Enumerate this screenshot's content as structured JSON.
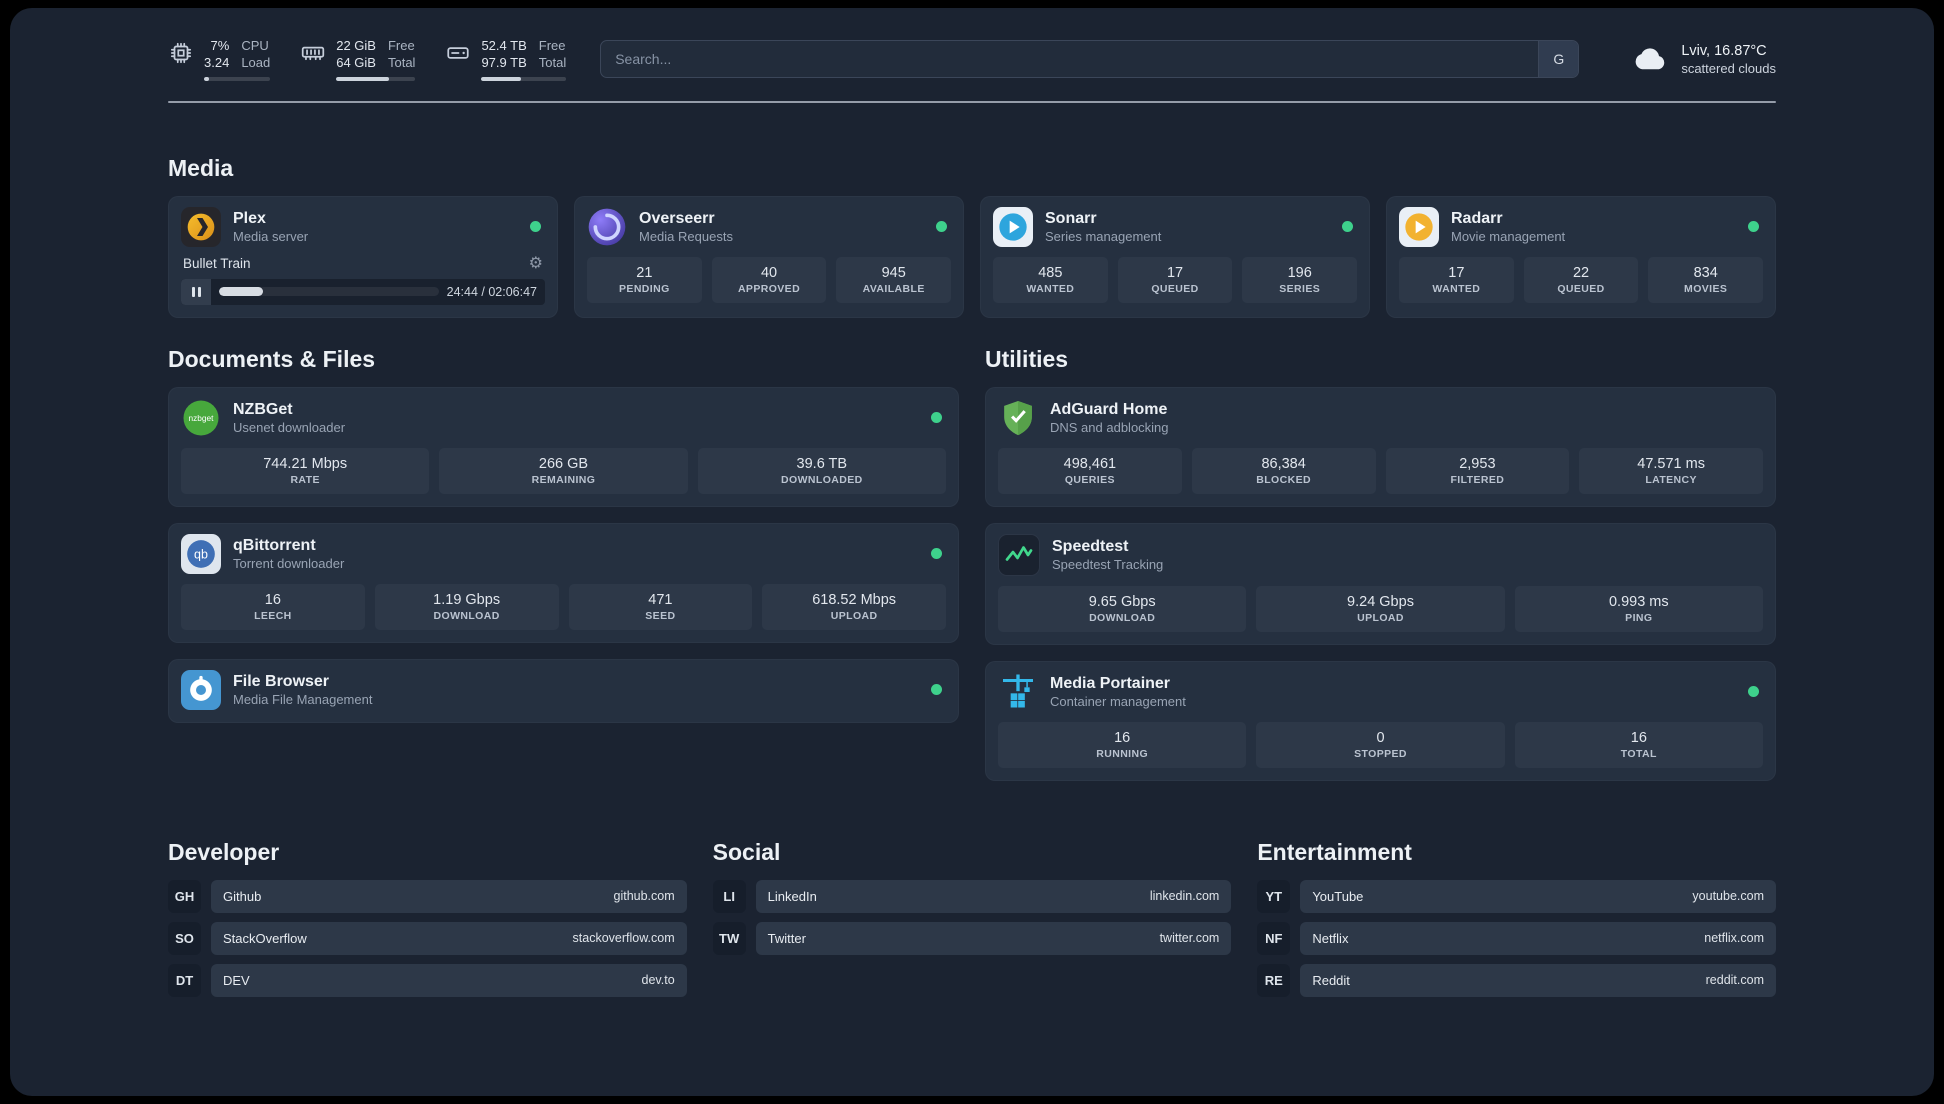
{
  "topbar": {
    "cpu": {
      "values": [
        "7%",
        "3.24"
      ],
      "labels": [
        "CPU",
        "Load"
      ],
      "progress_pct": 7
    },
    "memory": {
      "values": [
        "22 GiB",
        "64 GiB"
      ],
      "labels": [
        "Free",
        "Total"
      ],
      "progress_pct": 66
    },
    "disk": {
      "values": [
        "52.4 TB",
        "97.9 TB"
      ],
      "labels": [
        "Free",
        "Total"
      ],
      "progress_pct": 47
    },
    "search": {
      "placeholder": "Search...",
      "engine_button": "G"
    },
    "weather": {
      "location": "Lviv, 16.87°C",
      "condition": "scattered clouds"
    }
  },
  "sections": {
    "media": {
      "title": "Media",
      "plex": {
        "name": "Plex",
        "subtitle": "Media server",
        "now_playing": "Bullet Train",
        "time": "24:44 / 02:06:47",
        "progress_pct": 20
      },
      "overseerr": {
        "name": "Overseerr",
        "subtitle": "Media Requests",
        "stats": [
          {
            "value": "21",
            "label": "PENDING"
          },
          {
            "value": "40",
            "label": "APPROVED"
          },
          {
            "value": "945",
            "label": "AVAILABLE"
          }
        ]
      },
      "sonarr": {
        "name": "Sonarr",
        "subtitle": "Series management",
        "stats": [
          {
            "value": "485",
            "label": "WANTED"
          },
          {
            "value": "17",
            "label": "QUEUED"
          },
          {
            "value": "196",
            "label": "SERIES"
          }
        ]
      },
      "radarr": {
        "name": "Radarr",
        "subtitle": "Movie management",
        "stats": [
          {
            "value": "17",
            "label": "WANTED"
          },
          {
            "value": "22",
            "label": "QUEUED"
          },
          {
            "value": "834",
            "label": "MOVIES"
          }
        ]
      }
    },
    "documents": {
      "title": "Documents & Files",
      "nzbget": {
        "name": "NZBGet",
        "subtitle": "Usenet downloader",
        "stats": [
          {
            "value": "744.21 Mbps",
            "label": "RATE"
          },
          {
            "value": "266 GB",
            "label": "REMAINING"
          },
          {
            "value": "39.6 TB",
            "label": "DOWNLOADED"
          }
        ]
      },
      "qbittorrent": {
        "name": "qBittorrent",
        "subtitle": "Torrent downloader",
        "stats": [
          {
            "value": "16",
            "label": "LEECH"
          },
          {
            "value": "1.19 Gbps",
            "label": "DOWNLOAD"
          },
          {
            "value": "471",
            "label": "SEED"
          },
          {
            "value": "618.52 Mbps",
            "label": "UPLOAD"
          }
        ]
      },
      "filebrowser": {
        "name": "File Browser",
        "subtitle": "Media File Management"
      }
    },
    "utilities": {
      "title": "Utilities",
      "adguard": {
        "name": "AdGuard Home",
        "subtitle": "DNS and adblocking",
        "stats": [
          {
            "value": "498,461",
            "label": "QUERIES"
          },
          {
            "value": "86,384",
            "label": "BLOCKED"
          },
          {
            "value": "2,953",
            "label": "FILTERED"
          },
          {
            "value": "47.571 ms",
            "label": "LATENCY"
          }
        ]
      },
      "speedtest": {
        "name": "Speedtest",
        "subtitle": "Speedtest Tracking",
        "stats": [
          {
            "value": "9.65 Gbps",
            "label": "DOWNLOAD"
          },
          {
            "value": "9.24 Gbps",
            "label": "UPLOAD"
          },
          {
            "value": "0.993 ms",
            "label": "PING"
          }
        ]
      },
      "portainer": {
        "name": "Media Portainer",
        "subtitle": "Container management",
        "stats": [
          {
            "value": "16",
            "label": "RUNNING"
          },
          {
            "value": "0",
            "label": "STOPPED"
          },
          {
            "value": "16",
            "label": "TOTAL"
          }
        ]
      }
    },
    "bookmarks": {
      "developer": {
        "title": "Developer",
        "items": [
          {
            "abbr": "GH",
            "name": "Github",
            "url": "github.com"
          },
          {
            "abbr": "SO",
            "name": "StackOverflow",
            "url": "stackoverflow.com"
          },
          {
            "abbr": "DT",
            "name": "DEV",
            "url": "dev.to"
          }
        ]
      },
      "social": {
        "title": "Social",
        "items": [
          {
            "abbr": "LI",
            "name": "LinkedIn",
            "url": "linkedin.com"
          },
          {
            "abbr": "TW",
            "name": "Twitter",
            "url": "twitter.com"
          }
        ]
      },
      "entertainment": {
        "title": "Entertainment",
        "items": [
          {
            "abbr": "YT",
            "name": "YouTube",
            "url": "youtube.com"
          },
          {
            "abbr": "NF",
            "name": "Netflix",
            "url": "netflix.com"
          },
          {
            "abbr": "RE",
            "name": "Reddit",
            "url": "reddit.com"
          }
        ]
      }
    }
  },
  "colors": {
    "status_online": "#3ed18c",
    "background": "#1b2331",
    "card": "#253040",
    "accent_green": "#41d98d"
  }
}
